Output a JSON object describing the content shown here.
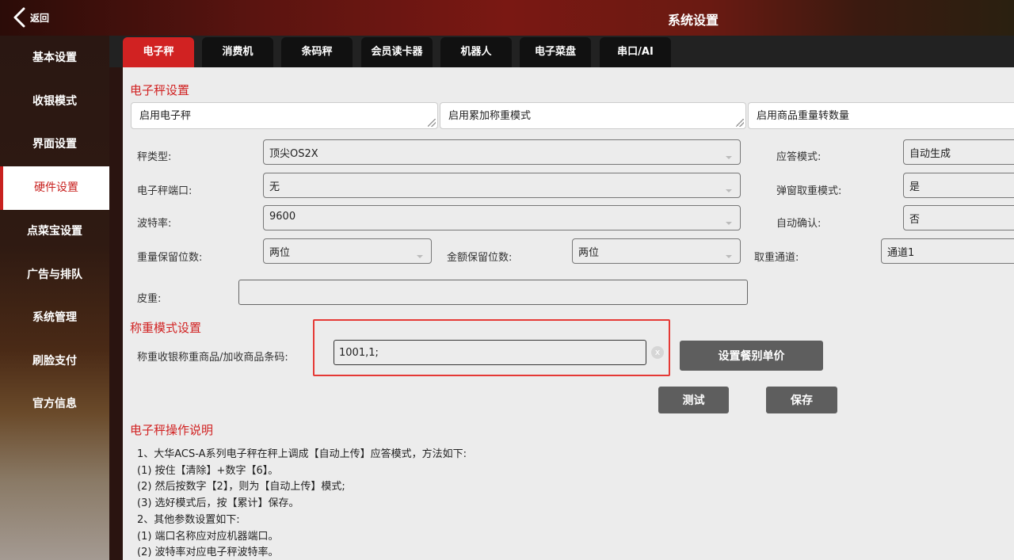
{
  "header": {
    "back_label": "返回",
    "title": "系统设置"
  },
  "sidebar": {
    "items": [
      {
        "label": "基本设置"
      },
      {
        "label": "收银模式"
      },
      {
        "label": "界面设置"
      },
      {
        "label": "硬件设置",
        "active": true
      },
      {
        "label": "点菜宝设置"
      },
      {
        "label": "广告与排队"
      },
      {
        "label": "系统管理"
      },
      {
        "label": "刷脸支付"
      },
      {
        "label": "官方信息"
      }
    ]
  },
  "tabs": [
    {
      "label": "电子秤",
      "active": true
    },
    {
      "label": "消费机"
    },
    {
      "label": "条码秤"
    },
    {
      "label": "会员读卡器"
    },
    {
      "label": "机器人"
    },
    {
      "label": "电子菜盘"
    },
    {
      "label": "串口/AI"
    }
  ],
  "scale_settings": {
    "title": "电子秤设置",
    "toggles": [
      {
        "label": "启用电子秤"
      },
      {
        "label": "启用累加称重模式"
      },
      {
        "label": "启用商品重量转数量"
      }
    ],
    "scale_type": {
      "label": "秤类型:",
      "value": "顶尖OS2X"
    },
    "scale_port": {
      "label": "电子秤端口:",
      "value": "无"
    },
    "baud_rate": {
      "label": "波特率:",
      "value": "9600"
    },
    "weight_decimals": {
      "label": "重量保留位数:",
      "value": "两位"
    },
    "amount_decimals": {
      "label": "金额保留位数:",
      "value": "两位"
    },
    "response_mode": {
      "label": "应答模式:",
      "value": "自动生成"
    },
    "popup_weight_mode": {
      "label": "弹窗取重模式:",
      "value": "是"
    },
    "auto_confirm": {
      "label": "自动确认:",
      "value": "否"
    },
    "weight_channel": {
      "label": "取重通道:",
      "value": "通道1"
    },
    "tare": {
      "label": "皮重:",
      "value": ""
    }
  },
  "weighing_mode": {
    "title": "称重模式设置",
    "barcode_label": "称重收银称重商品/加收商品条码:",
    "barcode_value": "1001,1;",
    "clear_symbol": "x",
    "set_price_button": "设置餐别单价",
    "test_button": "测试",
    "save_button": "保存"
  },
  "instructions": {
    "title": "电子秤操作说明",
    "lines": [
      "1、大华ACS-A系列电子秤在秤上调成【自动上传】应答模式，方法如下:",
      "(1) 按住【清除】+数字【6】。",
      "(2) 然后按数字【2】，则为【自动上传】模式;",
      "(3) 选好模式后，按【累计】保存。",
      "2、其他参数设置如下:",
      "(1) 端口名称应对应机器端口。",
      "(2) 波特率对应电子秤波特率。"
    ]
  },
  "colors": {
    "accent": "#d12222",
    "button": "#5e5e5e",
    "highlight_box": "#e53935"
  }
}
